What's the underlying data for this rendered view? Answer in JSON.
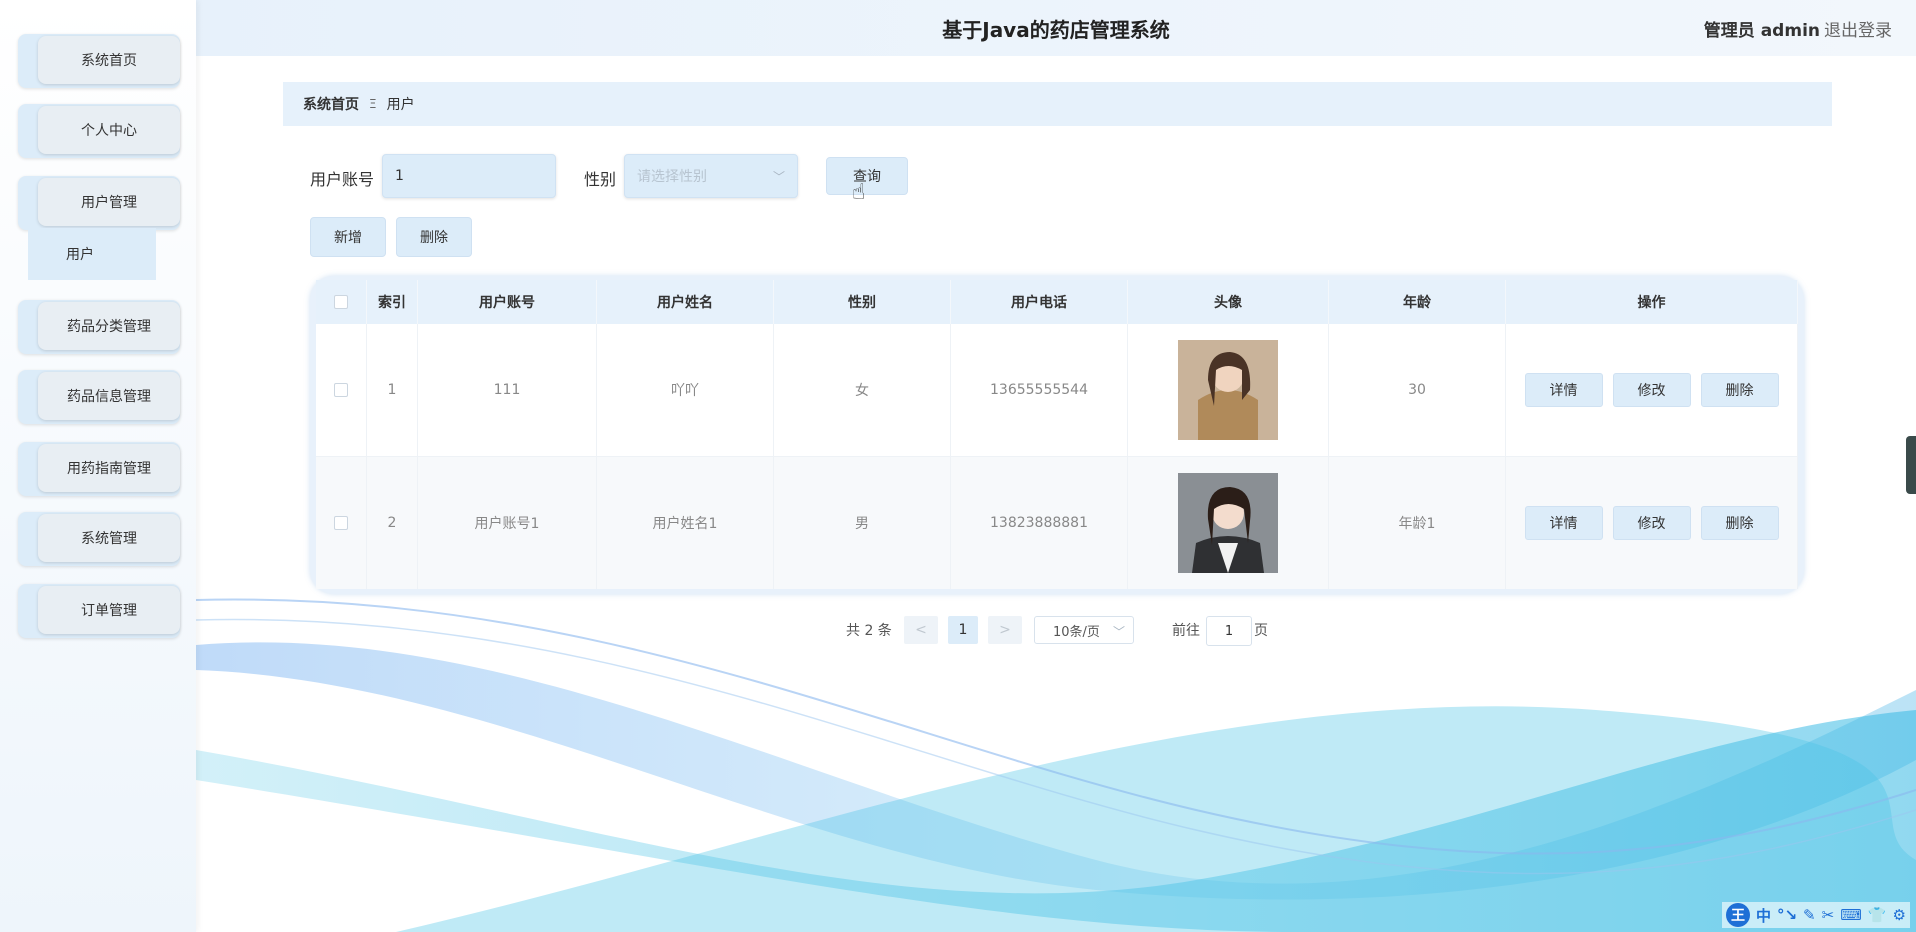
{
  "header": {
    "title": "基于Java的药店管理系统",
    "admin_label": "管理员 admin",
    "logout": "退出登录"
  },
  "sidebar": {
    "items": [
      {
        "label": "系统首页"
      },
      {
        "label": "个人中心"
      },
      {
        "label": "用户管理"
      },
      {
        "label": "药品分类管理"
      },
      {
        "label": "药品信息管理"
      },
      {
        "label": "用药指南管理"
      },
      {
        "label": "系统管理"
      },
      {
        "label": "订单管理"
      }
    ],
    "sub_item": "用户"
  },
  "breadcrumb": {
    "home": "系统首页",
    "separator": "Ξ",
    "current": "用户"
  },
  "search": {
    "account_label": "用户账号",
    "account_value": "1",
    "gender_label": "性别",
    "gender_placeholder": "请选择性别",
    "query_button": "查询"
  },
  "actions": {
    "add": "新增",
    "delete": "删除"
  },
  "table": {
    "columns": [
      "索引",
      "用户账号",
      "用户姓名",
      "性别",
      "用户电话",
      "头像",
      "年龄",
      "操作"
    ],
    "rows": [
      {
        "index": "1",
        "account": "111",
        "name": "吖吖",
        "gender": "女",
        "phone": "13655555544",
        "age": "30"
      },
      {
        "index": "2",
        "account": "用户账号1",
        "name": "用户姓名1",
        "gender": "男",
        "phone": "13823888881",
        "age": "年龄1"
      }
    ],
    "row_actions": {
      "detail": "详情",
      "edit": "修改",
      "delete": "删除"
    }
  },
  "pagination": {
    "total": "共 2 条",
    "prev": "<",
    "current": "1",
    "next": ">",
    "page_size": "10条/页",
    "goto_label": "前往",
    "goto_value": "1",
    "goto_suffix": "页"
  },
  "ime": {
    "logo": "王",
    "mode": "中",
    "icons": [
      "°↘",
      "✎",
      "✂",
      "⌨",
      "👕",
      "⚙"
    ]
  },
  "icons": {
    "select_chevron": "chevron-down-icon",
    "cursor": "hand-cursor-icon"
  },
  "colors": {
    "accent": "#dcecf9",
    "header_bg": "#e7f1fb",
    "ime_blue": "#1e6fd6"
  }
}
